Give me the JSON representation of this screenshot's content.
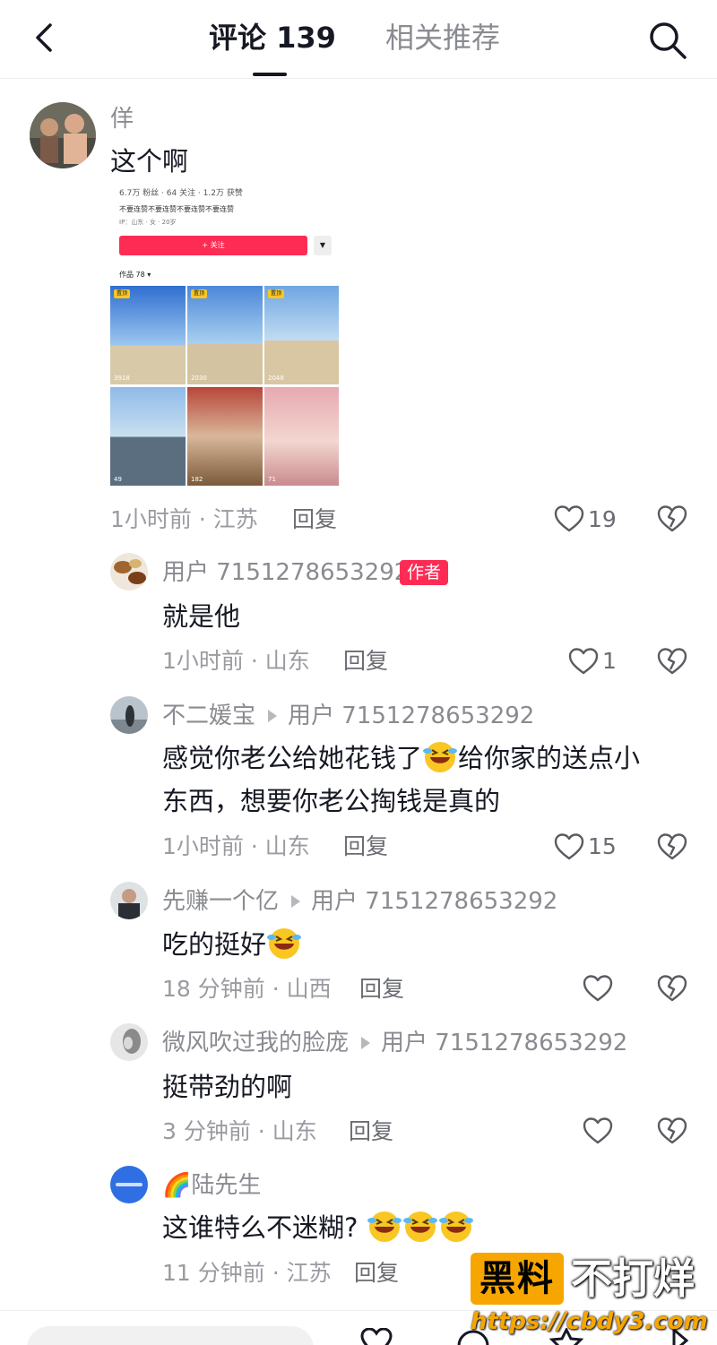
{
  "header": {
    "tab_comments": "评论 139",
    "tab_related": "相关推荐"
  },
  "main_comment": {
    "user": "佯",
    "text": "这个啊",
    "time_location": "1小时前 · 江苏",
    "reply_label": "回复",
    "likes": "19",
    "image": {
      "stats": "6.7万 粉丝 · 64 关注 · 1.2万 获赞",
      "bio": "不要连赞不要连赞不要连赞不要连赞",
      "tags": "IP：山东 · 女 · 20岁",
      "follow_label": "+ 关注",
      "dropdown": "▼",
      "works_label": "作品 78 ▾",
      "pinned_label": "置顶",
      "counts": [
        "3918",
        "2030",
        "2048",
        "49",
        "182",
        "71"
      ]
    }
  },
  "replies": [
    {
      "user": "用户 7151278653292",
      "badge": "作者",
      "text": "就是他",
      "time_location": "1小时前 · 山东",
      "reply_label": "回复",
      "likes": "1"
    },
    {
      "user": "不二媛宝",
      "target": "用户 7151278653292",
      "text_a": "感觉你老公给她花钱了",
      "text_b": "给你家的送点小",
      "text_c": "东西，想要你老公掏钱是真的",
      "time_location": "1小时前 · 山东",
      "reply_label": "回复",
      "likes": "15"
    },
    {
      "user": "先赚一个亿",
      "target": "用户 7151278653292",
      "text": "吃的挺好",
      "time_location": "18 分钟前 · 山西",
      "reply_label": "回复",
      "likes": ""
    },
    {
      "user": "微风吹过我的脸庞",
      "target": "用户 7151278653292",
      "text": "挺带劲的啊",
      "time_location": "3 分钟前 · 山东",
      "reply_label": "回复",
      "likes": ""
    },
    {
      "user": "🌈陆先生",
      "text": "这谁特么不迷糊?",
      "time_location": "11 分钟前 · 江苏",
      "reply_label": "回复",
      "likes": ""
    }
  ],
  "watermark": {
    "box": "黑料",
    "text": "不打烊",
    "url": "https://cbdy3.com"
  },
  "icons": {
    "back": "chevron-left-icon",
    "search": "search-icon",
    "like": "heart-icon",
    "dislike": "broken-heart-icon",
    "emoji": "laughing-crying-emoji"
  },
  "colors": {
    "accent": "#fe2c55",
    "watermark": "#f7a600"
  }
}
